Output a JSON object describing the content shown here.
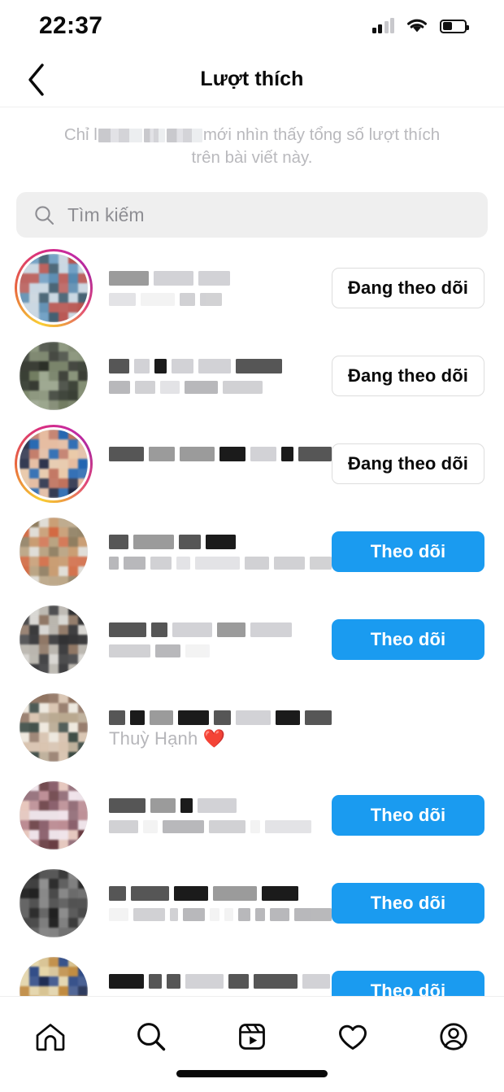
{
  "status_bar": {
    "time": "22:37",
    "signal_icon": "cellular-signal-icon",
    "signal_bars_filled": 2,
    "signal_bars_total": 4,
    "wifi_icon": "wifi-icon",
    "battery_icon": "battery-icon",
    "battery_level_pct": 45
  },
  "header": {
    "back_icon": "chevron-left-icon",
    "title": "Lượt thích"
  },
  "subtitle": {
    "prefix": "Chỉ l",
    "middle": "",
    "suffix": "mới nhìn thấy tổng số lượt thích trên bài viết này.",
    "full_text": "Chỉ l███ ██ ████ mới nhìn thấy tổng số lượt thích trên bài viết này."
  },
  "search": {
    "icon": "search-icon",
    "placeholder": "Tìm kiếm",
    "value": ""
  },
  "buttons": {
    "following_label": "Đang theo dõi",
    "follow_label": "Theo dõi"
  },
  "colors": {
    "follow_blue": "#1a9bf0",
    "border_gray": "#dddddd",
    "text_black": "#0a0a0a",
    "muted_gray": "#b9b9bd",
    "search_bg": "#efefef",
    "divider": "#efefef"
  },
  "likes_list": [
    {
      "index": 1,
      "username": "",
      "display_name": "",
      "username_redacted": true,
      "display_name_redacted": true,
      "has_story_ring": true,
      "button": "Đang theo dõi",
      "button_state": "following",
      "avatar_palette": [
        "#6f9fc4",
        "#4d84ad",
        "#b8534f",
        "#2e4f63",
        "#c9d7e2"
      ]
    },
    {
      "index": 2,
      "username": "",
      "display_name": "",
      "username_redacted": true,
      "display_name_redacted": true,
      "has_story_ring": false,
      "button": "Đang theo dõi",
      "button_state": "following",
      "avatar_palette": [
        "#6f7a5e",
        "#353b30",
        "#9aa58c",
        "#22261d",
        "#7e8a6d"
      ]
    },
    {
      "index": 3,
      "username": "",
      "display_name": "",
      "username_redacted": true,
      "display_name_redacted": false,
      "has_story_ring": true,
      "button": "Đang theo dõi",
      "button_state": "following",
      "avatar_palette": [
        "#1f63b0",
        "#e6bca0",
        "#1d2440",
        "#c0705a",
        "#eac9a8"
      ]
    },
    {
      "index": 4,
      "username": "",
      "display_name": "",
      "username_redacted": true,
      "display_name_redacted": true,
      "has_story_ring": false,
      "button": "Theo dõi",
      "button_state": "follow",
      "avatar_palette": [
        "#b9a27f",
        "#d36a43",
        "#8d7b5c",
        "#c89a6e",
        "#e0ddd6"
      ]
    },
    {
      "index": 5,
      "username": "",
      "display_name": "",
      "username_redacted": true,
      "display_name_redacted": true,
      "has_story_ring": false,
      "button": "Theo dõi",
      "button_state": "follow",
      "avatar_palette": [
        "#d8d6d2",
        "#3a3a3c",
        "#8d7462",
        "#b9b5ad",
        "#2c2c2e"
      ]
    },
    {
      "index": 6,
      "username": "",
      "display_name": "Thuỳ Hạnh ❤️",
      "username_redacted": true,
      "display_name_redacted": false,
      "has_story_ring": false,
      "button": "",
      "button_state": "none",
      "avatar_palette": [
        "#b9a88f",
        "#2b3b34",
        "#d9c3ae",
        "#8d6f5c",
        "#efe9df"
      ]
    },
    {
      "index": 7,
      "username": "",
      "display_name": "",
      "username_redacted": true,
      "display_name_redacted": true,
      "has_story_ring": false,
      "button": "Theo dõi",
      "button_state": "follow",
      "avatar_palette": [
        "#e7c6bc",
        "#5c2b31",
        "#b9848c",
        "#f0e3ea",
        "#8a5f6b"
      ]
    },
    {
      "index": 8,
      "username": "",
      "display_name": "",
      "username_redacted": true,
      "display_name_redacted": true,
      "has_story_ring": false,
      "button": "Theo dõi",
      "button_state": "follow",
      "avatar_palette": [
        "#2a2a2a",
        "#555555",
        "#111111",
        "#7a7a7a",
        "#3d3d3d"
      ]
    },
    {
      "index": 9,
      "username": "",
      "display_name": "",
      "username_redacted": true,
      "display_name_redacted": true,
      "has_story_ring": false,
      "button": "Theo dõi",
      "button_state": "follow",
      "avatar_palette": [
        "#e6d6a8",
        "#1d2c52",
        "#c08a3e",
        "#2f4a86",
        "#d8c391"
      ]
    }
  ],
  "tabbar": {
    "items": [
      {
        "name": "home-icon",
        "label": "Trang chủ"
      },
      {
        "name": "search-icon",
        "label": "Tìm kiếm"
      },
      {
        "name": "reels-icon",
        "label": "Reels"
      },
      {
        "name": "heart-icon",
        "label": "Hoạt động"
      },
      {
        "name": "profile-icon",
        "label": "Trang cá nhân"
      }
    ],
    "home_indicator": "home-indicator"
  }
}
